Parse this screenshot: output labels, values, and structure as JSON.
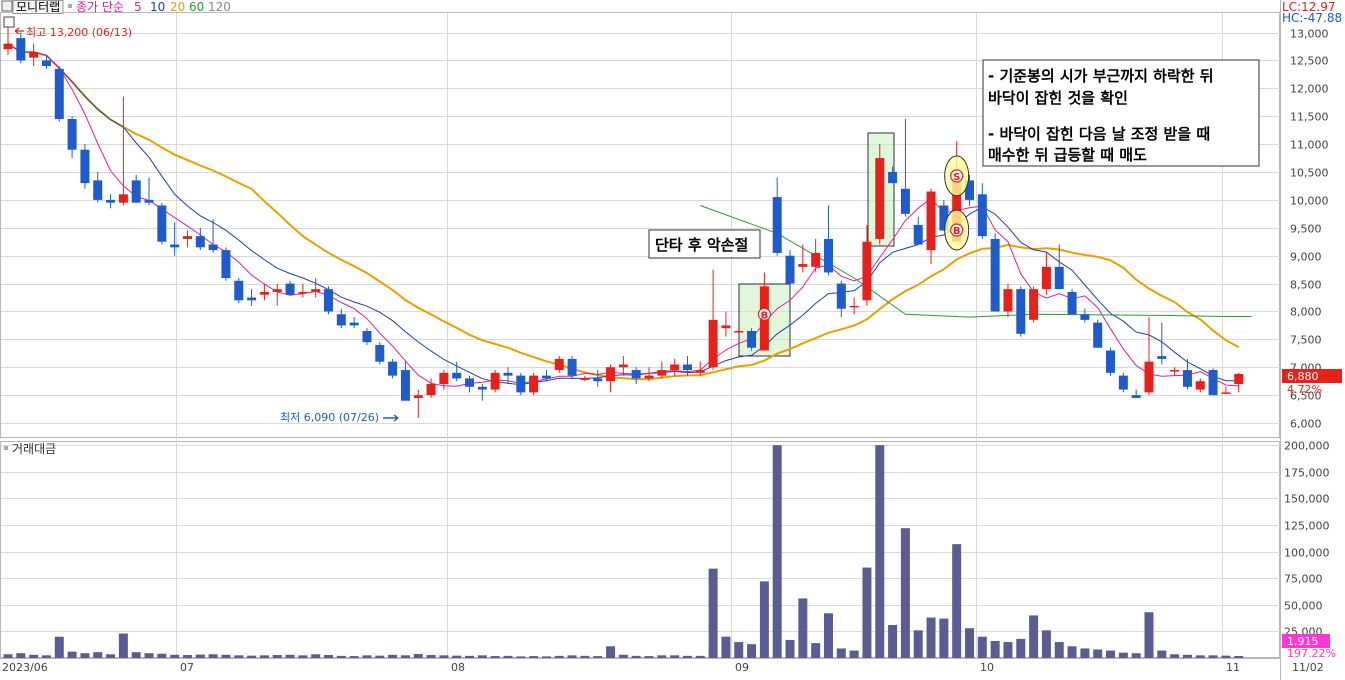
{
  "toolbar": {
    "title": "모니터랩",
    "ma_label": "종가 단순",
    "ma_periods": [
      "5",
      "10",
      "20",
      "60",
      "120"
    ],
    "ma_colors": [
      "#e020a0",
      "#2040b0",
      "#e8a000",
      "#2a9a3a",
      "#888888"
    ]
  },
  "info": {
    "lc": "LC:12.97",
    "hc": "HC:-47.88"
  },
  "markers": {
    "high": "최고 13,200 (06/13)",
    "low": "최저 6,090 (07/26)",
    "price_badge": "6,880",
    "price_pct": "4.72%",
    "vol_badge": "1,915",
    "vol_pct": "197.22%"
  },
  "volume_panel": {
    "title": "거래대금"
  },
  "annotations": {
    "box1": "단타 후 악손절",
    "box2_lines": [
      "- 기준봉의 시가 부근까지 하락한 뒤",
      "바닥이 잡힌 것을 확인",
      "",
      "- 바닥이 잡힌 다음 날 조정 받을 때",
      "매수한 뒤 급등할 때 매도"
    ],
    "signal_b": "B",
    "signal_s": "S"
  },
  "colors": {
    "up": "#e8201a",
    "down": "#1e5bcc",
    "volume": "#5c5c94",
    "grid": "#d9d9d9",
    "badge_red": "#e8201a",
    "badge_pink": "#ff36d8",
    "highlight_box": "#c8f0c0",
    "signal_fill": "#ffff99"
  },
  "chart_data": [
    {
      "type": "candlestick",
      "title": "",
      "price_axis": {
        "ticks": [
          6000,
          6500,
          7000,
          7500,
          8000,
          8500,
          9000,
          9500,
          10000,
          10500,
          11000,
          11500,
          12000,
          12500,
          13000
        ],
        "labels": [
          "6,000",
          "6,500",
          "7,000",
          "7,500",
          "8,000",
          "8,500",
          "9,000",
          "9,500",
          "10,000",
          "10,500",
          "11,000",
          "11,500",
          "12,000",
          "12,500",
          "13,000"
        ],
        "ylim": [
          5750,
          13350
        ]
      },
      "date_axis": [
        "2023/06",
        "07",
        "08",
        "09",
        "10",
        "11"
      ],
      "date_axis_right": "11/02",
      "candles": [
        {
          "o": 12700,
          "h": 13200,
          "l": 12600,
          "c": 12800
        },
        {
          "o": 12900,
          "h": 13000,
          "l": 12450,
          "c": 12500
        },
        {
          "o": 12550,
          "h": 12800,
          "l": 12400,
          "c": 12650
        },
        {
          "o": 12500,
          "h": 12600,
          "l": 12350,
          "c": 12400
        },
        {
          "o": 12350,
          "h": 12400,
          "l": 11400,
          "c": 11450
        },
        {
          "o": 11450,
          "h": 11500,
          "l": 10750,
          "c": 10900
        },
        {
          "o": 10900,
          "h": 11000,
          "l": 10200,
          "c": 10300
        },
        {
          "o": 10350,
          "h": 10500,
          "l": 9950,
          "c": 10000
        },
        {
          "o": 10000,
          "h": 10100,
          "l": 9850,
          "c": 9950
        },
        {
          "o": 9950,
          "h": 11850,
          "l": 9900,
          "c": 10100
        },
        {
          "o": 10350,
          "h": 10450,
          "l": 9950,
          "c": 9950
        },
        {
          "o": 10000,
          "h": 10400,
          "l": 9900,
          "c": 9950
        },
        {
          "o": 9900,
          "h": 9950,
          "l": 9200,
          "c": 9250
        },
        {
          "o": 9200,
          "h": 9600,
          "l": 9000,
          "c": 9150
        },
        {
          "o": 9300,
          "h": 9450,
          "l": 9150,
          "c": 9350
        },
        {
          "o": 9350,
          "h": 9500,
          "l": 9100,
          "c": 9150
        },
        {
          "o": 9200,
          "h": 9650,
          "l": 9050,
          "c": 9100
        },
        {
          "o": 9100,
          "h": 9150,
          "l": 8550,
          "c": 8600
        },
        {
          "o": 8550,
          "h": 8600,
          "l": 8150,
          "c": 8200
        },
        {
          "o": 8250,
          "h": 8400,
          "l": 8100,
          "c": 8200
        },
        {
          "o": 8300,
          "h": 8500,
          "l": 8200,
          "c": 8350
        },
        {
          "o": 8350,
          "h": 8500,
          "l": 8100,
          "c": 8400
        },
        {
          "o": 8500,
          "h": 8550,
          "l": 8300,
          "c": 8300
        },
        {
          "o": 8350,
          "h": 8500,
          "l": 8250,
          "c": 8350
        },
        {
          "o": 8350,
          "h": 8600,
          "l": 8250,
          "c": 8400
        },
        {
          "o": 8400,
          "h": 8450,
          "l": 7950,
          "c": 8000
        },
        {
          "o": 7950,
          "h": 8050,
          "l": 7700,
          "c": 7750
        },
        {
          "o": 7800,
          "h": 7900,
          "l": 7700,
          "c": 7750
        },
        {
          "o": 7650,
          "h": 7700,
          "l": 7400,
          "c": 7450
        },
        {
          "o": 7400,
          "h": 7450,
          "l": 7050,
          "c": 7100
        },
        {
          "o": 7100,
          "h": 7150,
          "l": 6800,
          "c": 6850
        },
        {
          "o": 6950,
          "h": 7100,
          "l": 6400,
          "c": 6400
        },
        {
          "o": 6450,
          "h": 6600,
          "l": 6090,
          "c": 6500
        },
        {
          "o": 6500,
          "h": 6800,
          "l": 6450,
          "c": 6700
        },
        {
          "o": 6700,
          "h": 6950,
          "l": 6600,
          "c": 6900
        },
        {
          "o": 6900,
          "h": 7100,
          "l": 6750,
          "c": 6800
        },
        {
          "o": 6800,
          "h": 6850,
          "l": 6550,
          "c": 6650
        },
        {
          "o": 6650,
          "h": 6700,
          "l": 6400,
          "c": 6600
        },
        {
          "o": 6600,
          "h": 6950,
          "l": 6550,
          "c": 6900
        },
        {
          "o": 6900,
          "h": 7000,
          "l": 6700,
          "c": 6850
        },
        {
          "o": 6850,
          "h": 6900,
          "l": 6500,
          "c": 6550
        },
        {
          "o": 6550,
          "h": 6900,
          "l": 6500,
          "c": 6850
        },
        {
          "o": 6850,
          "h": 6950,
          "l": 6750,
          "c": 6800
        },
        {
          "o": 6950,
          "h": 7200,
          "l": 6900,
          "c": 7150
        },
        {
          "o": 7150,
          "h": 7200,
          "l": 6800,
          "c": 6850
        },
        {
          "o": 6800,
          "h": 6850,
          "l": 6750,
          "c": 6800
        },
        {
          "o": 6800,
          "h": 6950,
          "l": 6650,
          "c": 6750
        },
        {
          "o": 6750,
          "h": 7050,
          "l": 6550,
          "c": 7000
        },
        {
          "o": 7000,
          "h": 7200,
          "l": 6850,
          "c": 7050
        },
        {
          "o": 6950,
          "h": 7000,
          "l": 6700,
          "c": 6800
        },
        {
          "o": 6800,
          "h": 7000,
          "l": 6750,
          "c": 6850
        },
        {
          "o": 6850,
          "h": 7100,
          "l": 6800,
          "c": 6950
        },
        {
          "o": 6950,
          "h": 7150,
          "l": 6850,
          "c": 7050
        },
        {
          "o": 7050,
          "h": 7200,
          "l": 6850,
          "c": 6950
        },
        {
          "o": 6900,
          "h": 7100,
          "l": 6850,
          "c": 6950
        },
        {
          "o": 7000,
          "h": 8750,
          "l": 6950,
          "c": 7850
        },
        {
          "o": 7700,
          "h": 8000,
          "l": 7550,
          "c": 7750
        },
        {
          "o": 7650,
          "h": 7700,
          "l": 7600,
          "c": 7650
        },
        {
          "o": 7650,
          "h": 7700,
          "l": 7300,
          "c": 7350
        },
        {
          "o": 7300,
          "h": 8700,
          "l": 7300,
          "c": 8450
        },
        {
          "o": 10050,
          "h": 10400,
          "l": 9000,
          "c": 9050
        },
        {
          "o": 9000,
          "h": 9100,
          "l": 8500,
          "c": 8500
        },
        {
          "o": 8800,
          "h": 9200,
          "l": 8700,
          "c": 8850
        },
        {
          "o": 8800,
          "h": 9300,
          "l": 8700,
          "c": 9050
        },
        {
          "o": 9300,
          "h": 9900,
          "l": 8650,
          "c": 8700
        },
        {
          "o": 8500,
          "h": 8550,
          "l": 7900,
          "c": 8050
        },
        {
          "o": 8100,
          "h": 8250,
          "l": 7950,
          "c": 8100
        },
        {
          "o": 8200,
          "h": 9550,
          "l": 8100,
          "c": 9250
        },
        {
          "o": 9300,
          "h": 11000,
          "l": 9200,
          "c": 10750
        },
        {
          "o": 10500,
          "h": 10600,
          "l": 10300,
          "c": 10300
        },
        {
          "o": 10200,
          "h": 11450,
          "l": 9700,
          "c": 9750
        },
        {
          "o": 9550,
          "h": 9700,
          "l": 9200,
          "c": 9200
        },
        {
          "o": 9100,
          "h": 10200,
          "l": 8850,
          "c": 10150
        },
        {
          "o": 9900,
          "h": 10000,
          "l": 9450,
          "c": 9450
        },
        {
          "o": 9250,
          "h": 11050,
          "l": 9250,
          "c": 10500
        },
        {
          "o": 10350,
          "h": 10450,
          "l": 9900,
          "c": 10000
        },
        {
          "o": 10100,
          "h": 10300,
          "l": 9300,
          "c": 9350
        },
        {
          "o": 9300,
          "h": 9400,
          "l": 8000,
          "c": 8000
        },
        {
          "o": 8000,
          "h": 8500,
          "l": 7900,
          "c": 8400
        },
        {
          "o": 8400,
          "h": 8450,
          "l": 7550,
          "c": 7600
        },
        {
          "o": 7850,
          "h": 8450,
          "l": 7800,
          "c": 8400
        },
        {
          "o": 8400,
          "h": 9050,
          "l": 8300,
          "c": 8800
        },
        {
          "o": 8800,
          "h": 9200,
          "l": 8400,
          "c": 8400
        },
        {
          "o": 8350,
          "h": 8400,
          "l": 7950,
          "c": 7950
        },
        {
          "o": 7950,
          "h": 8050,
          "l": 7800,
          "c": 7850
        },
        {
          "o": 7800,
          "h": 7850,
          "l": 7350,
          "c": 7350
        },
        {
          "o": 7300,
          "h": 7350,
          "l": 6850,
          "c": 6900
        },
        {
          "o": 6850,
          "h": 6900,
          "l": 6550,
          "c": 6600
        },
        {
          "o": 6500,
          "h": 6600,
          "l": 6450,
          "c": 6450
        },
        {
          "o": 6550,
          "h": 7900,
          "l": 6500,
          "c": 7100
        },
        {
          "o": 7200,
          "h": 7800,
          "l": 7050,
          "c": 7150
        },
        {
          "o": 6950,
          "h": 7000,
          "l": 6850,
          "c": 6950
        },
        {
          "o": 6950,
          "h": 7150,
          "l": 6600,
          "c": 6650
        },
        {
          "o": 6600,
          "h": 6800,
          "l": 6550,
          "c": 6750
        },
        {
          "o": 6950,
          "h": 6980,
          "l": 6500,
          "c": 6500
        },
        {
          "o": 6550,
          "h": 6650,
          "l": 6520,
          "c": 6550
        },
        {
          "o": 6700,
          "h": 6900,
          "l": 6550,
          "c": 6880
        }
      ],
      "ma60": [
        {
          "i": 54,
          "v": 9900
        },
        {
          "i": 60,
          "v": 9400
        },
        {
          "i": 66,
          "v": 8600
        },
        {
          "i": 70,
          "v": 7950
        },
        {
          "i": 75,
          "v": 7900
        },
        {
          "i": 80,
          "v": 7950
        },
        {
          "i": 90,
          "v": 7930
        },
        {
          "i": 95,
          "v": 7910
        },
        {
          "i": 97,
          "v": 7910
        }
      ]
    },
    {
      "type": "bar",
      "title": "거래대금",
      "y_axis": {
        "ticks": [
          25000,
          50000,
          75000,
          100000,
          125000,
          150000,
          175000,
          200000
        ],
        "labels": [
          "25,000",
          "50,000",
          "75,000",
          "100,000",
          "125,000",
          "150,000",
          "175,000",
          "200,000"
        ],
        "ylim": [
          0,
          203000
        ]
      },
      "values": [
        3500,
        4500,
        3000,
        2500,
        20000,
        6000,
        4500,
        5500,
        3500,
        23000,
        5500,
        4500,
        4000,
        3000,
        2800,
        3200,
        3500,
        3000,
        2500,
        2200,
        2500,
        2800,
        3000,
        2500,
        3500,
        2800,
        2000,
        1800,
        2500,
        2200,
        3000,
        2500,
        3800,
        2800,
        2500,
        2200,
        2000,
        2500,
        1800,
        2000,
        1500,
        1800,
        1500,
        2000,
        2500,
        2000,
        1800,
        11000,
        3000,
        2000,
        1800,
        2500,
        2500,
        2000,
        2000,
        84000,
        20000,
        15000,
        13000,
        72000,
        200000,
        17000,
        56000,
        14000,
        42000,
        9000,
        7000,
        85000,
        200000,
        31000,
        122000,
        26000,
        38000,
        37000,
        107000,
        28000,
        20000,
        16000,
        15000,
        18000,
        40000,
        26000,
        15000,
        11000,
        9000,
        8000,
        7000,
        5000,
        4500,
        43000,
        7000,
        3500,
        3000,
        2500,
        2500,
        2200,
        1915
      ]
    }
  ]
}
